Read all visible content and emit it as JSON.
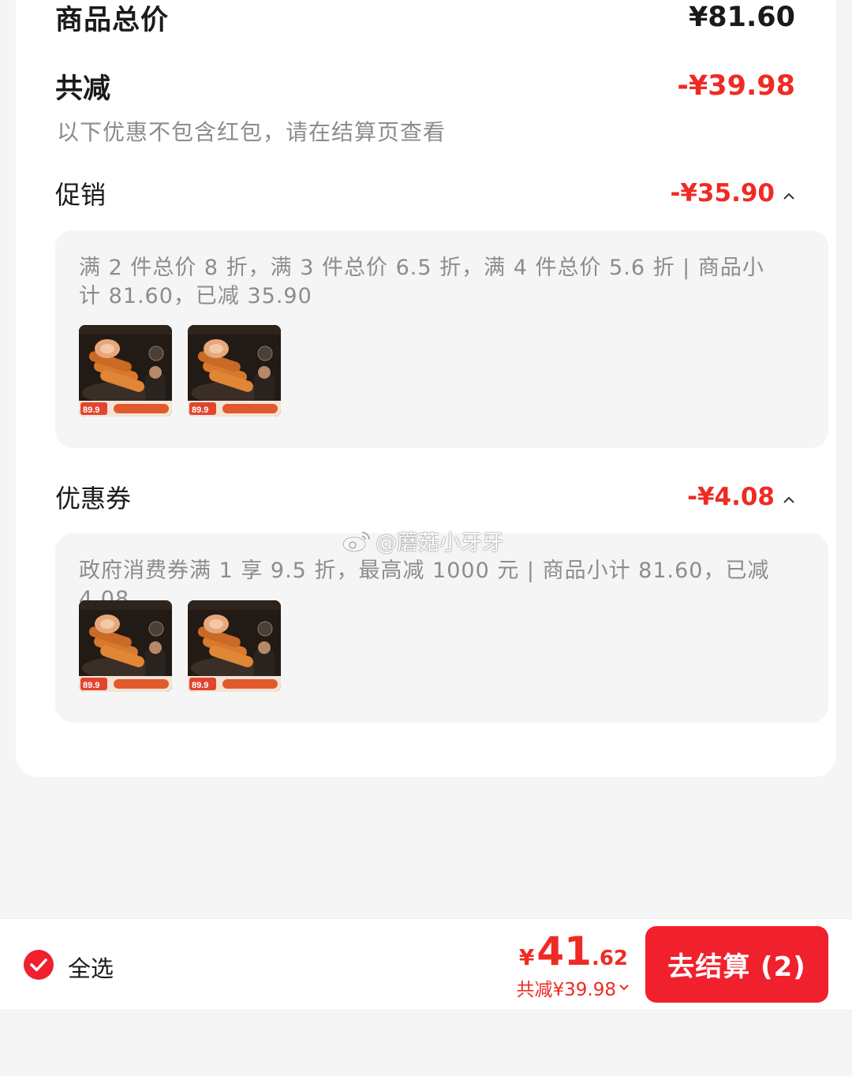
{
  "summary": {
    "total_label": "商品总价",
    "total_value": "¥81.60",
    "reduce_label": "共减",
    "reduce_value": "-¥39.98",
    "note": "以下优惠不包含红包，请在结算页查看"
  },
  "promotion": {
    "label": "促销",
    "value": "-¥35.90",
    "description": "满 2 件总价 8 折，满 3 件总价 6.5 折，满 4 件总价 5.6 折 | 商品小计 81.60，已减 35.90",
    "thumb_price": "89.9"
  },
  "coupon": {
    "label": "优惠券",
    "value": "-¥4.08",
    "description": "政府消费券满 1 享 9.5 折，最高减 1000 元 | 商品小计 81.60，已减 4.08",
    "thumb_price": "89.9"
  },
  "watermark": "@蘑菇小牙牙",
  "footer": {
    "select_all": "全选",
    "currency": "¥",
    "price_int": "41",
    "price_dec": ".62",
    "saved": "共减¥39.98",
    "checkout": "去结算 (2)"
  },
  "colors": {
    "accent": "#ee2b24",
    "button": "#f0202d"
  },
  "icons": [
    "chevron-up-icon",
    "chevron-down-icon",
    "check-circle-icon",
    "weibo-icon"
  ]
}
